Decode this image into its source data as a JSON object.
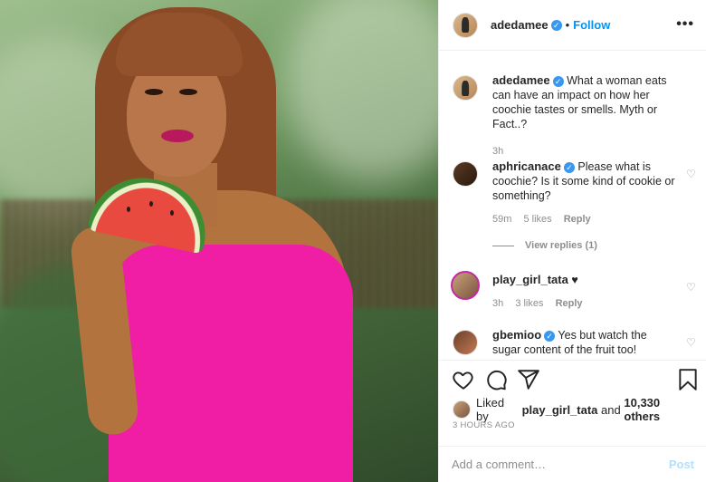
{
  "post": {
    "author": "adedamee",
    "follow_label": "Follow",
    "dot": "•",
    "more_label": "•••"
  },
  "caption": {
    "author": "adedamee",
    "text": "What a woman eats can have an impact on how her coochie tastes or smells. Myth or Fact..?",
    "time": "3h"
  },
  "comments": [
    {
      "author": "aphricanace",
      "verified": true,
      "text": "Please what is coochie? Is it some kind of cookie or something?",
      "time": "59m",
      "likes": "5 likes",
      "reply": "Reply"
    },
    {
      "author": "play_girl_tata",
      "verified": false,
      "text": "♥",
      "time": "3h",
      "likes": "3 likes",
      "reply": "Reply"
    },
    {
      "author": "gbemioo",
      "verified": true,
      "text": "Yes but watch the sugar content of the fruit too!"
    }
  ],
  "view_replies": "View replies (1)",
  "liked_by": {
    "prefix": "Liked by",
    "user": "play_girl_tata",
    "conj": "and",
    "others": "10,330 others"
  },
  "time_ago": "3 HOURS AGO",
  "comment_box": {
    "placeholder": "Add a comment…",
    "post_label": "Post"
  },
  "icons": {
    "like": "heart-icon",
    "comment": "comment-icon",
    "share": "share-icon",
    "save": "bookmark-icon",
    "verified": "verified-badge-icon"
  },
  "colors": {
    "link": "#0095f6",
    "verified": "#3897f0",
    "muted": "#8e8e8e",
    "post_disabled": "#b2dffc",
    "dress": "#ef1ea4"
  }
}
